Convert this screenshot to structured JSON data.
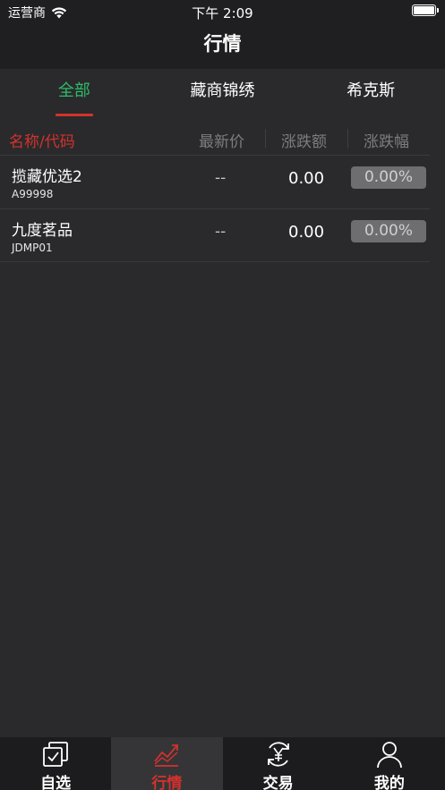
{
  "status_bar": {
    "carrier": "运营商",
    "time": "下午 2:09"
  },
  "nav": {
    "title": "行情"
  },
  "tabs": [
    {
      "label": "全部",
      "active": true
    },
    {
      "label": "藏商锦绣",
      "active": false
    },
    {
      "label": "希克斯",
      "active": false
    }
  ],
  "list_header": {
    "name_code": "名称/代码",
    "latest_price": "最新价",
    "change_amount": "涨跌额",
    "change_pct": "涨跌幅"
  },
  "rows": [
    {
      "name": "揽藏优选2",
      "code": "A99998",
      "price": "--",
      "change": "0.00",
      "pct": "0.00%"
    },
    {
      "name": "九度茗品",
      "code": "JDMP01",
      "price": "--",
      "change": "0.00",
      "pct": "0.00%"
    }
  ],
  "tab_bar": [
    {
      "label": "自选",
      "icon": "watchlist-icon",
      "active": false
    },
    {
      "label": "行情",
      "icon": "market-chart-icon",
      "active": true
    },
    {
      "label": "交易",
      "icon": "trade-yuan-icon",
      "active": false
    },
    {
      "label": "我的",
      "icon": "profile-icon",
      "active": false
    }
  ],
  "colors": {
    "active_tab": "#2ebd69",
    "accent_red": "#d2322d",
    "background": "#2a2a2c",
    "bar_background": "#1f1f21"
  }
}
